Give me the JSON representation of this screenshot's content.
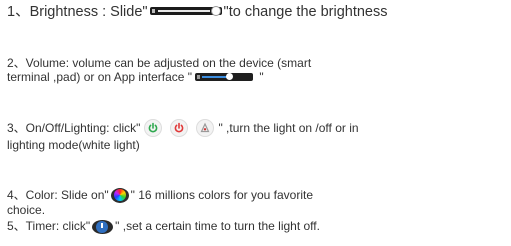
{
  "items": [
    {
      "before": "1、Brightness : Slide\"",
      "after": "\"to change the brightness"
    },
    {
      "line1": "2、Volume: volume can be adjusted on the  device (smart",
      "before": "terminal ,pad) or on App interface \"",
      "after": " \""
    },
    {
      "before": "3、On/Off/Lighting: click\"",
      "after": "\" ,turn the light on /off or in",
      "line2": "lighting mode(white light)"
    },
    {
      "before": "4、Color: Slide on\"",
      "after": "\" 16 millions colors for you favorite",
      "line2": "choice."
    },
    {
      "before": "5、Timer: click\"",
      "after": "\" ,set a certain time to turn the light off."
    }
  ],
  "icons": {
    "brightness_slider": "brightness-slider-icon",
    "volume_slider": "volume-slider-icon",
    "power_green": "power-icon",
    "power_red": "power-icon",
    "lighting": "lighting-mode-icon",
    "color_wheel": "color-wheel-icon",
    "timer": "timer-icon"
  },
  "colors": {
    "text": "#333333",
    "power_green": "#2fa84f",
    "power_red": "#e03a3a",
    "volume_fill": "#3c8ee0"
  }
}
